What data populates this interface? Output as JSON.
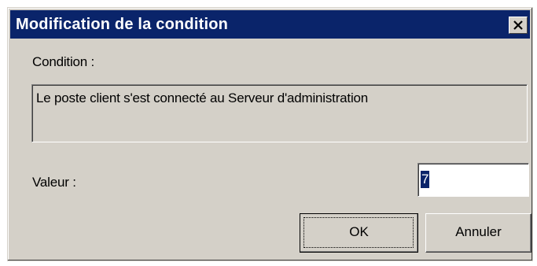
{
  "window": {
    "title": "Modification de la condition",
    "close_symbol": "×"
  },
  "condition": {
    "label": "Condition :",
    "text": "Le poste client s'est connecté au Serveur d'administration"
  },
  "value": {
    "label": "Valeur :",
    "input_value": "7"
  },
  "buttons": {
    "ok_label": "OK",
    "cancel_label": "Annuler"
  },
  "colors": {
    "titlebar": "#0a246a",
    "dialog_bg": "#d4d0c8",
    "selection": "#0a246a"
  }
}
